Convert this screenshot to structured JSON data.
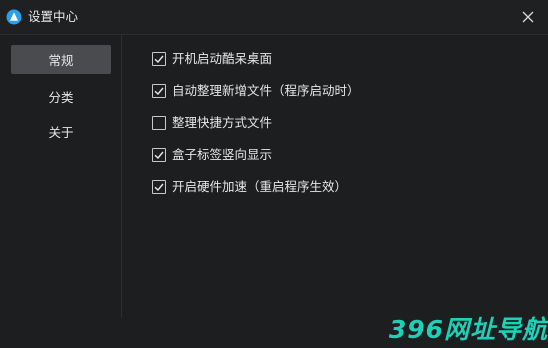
{
  "window": {
    "title": "设置中心",
    "accent": "#2aa0ea"
  },
  "sidebar": {
    "items": [
      {
        "label": "常规",
        "active": true
      },
      {
        "label": "分类",
        "active": false
      },
      {
        "label": "关于",
        "active": false
      }
    ]
  },
  "options": [
    {
      "label": "开机启动酷呆桌面",
      "checked": true
    },
    {
      "label": "自动整理新增文件（程序启动时）",
      "checked": true
    },
    {
      "label": "整理快捷方式文件",
      "checked": false
    },
    {
      "label": "盒子标签竖向显示",
      "checked": true
    },
    {
      "label": "开启硬件加速（重启程序生效）",
      "checked": true
    }
  ],
  "watermark": {
    "text": "396网址导航",
    "color": "#1fe0c4"
  }
}
